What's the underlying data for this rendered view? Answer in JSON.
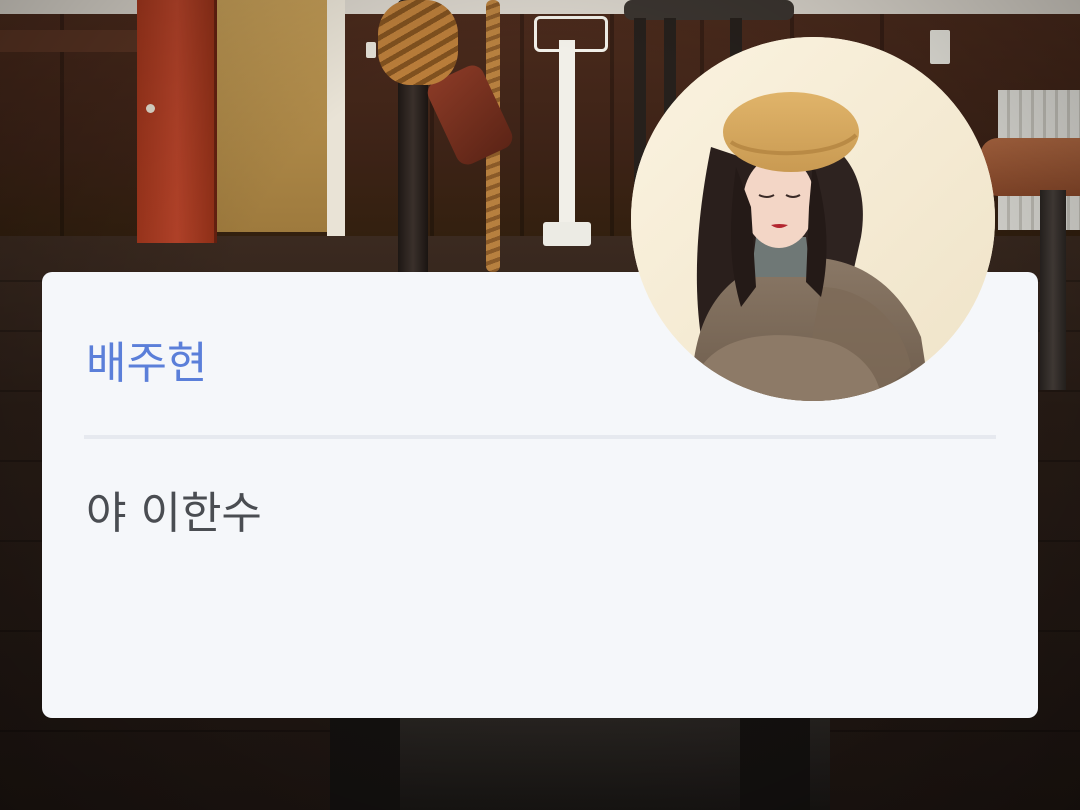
{
  "card": {
    "sender_name": "배주현",
    "message_text": "야 이한수"
  },
  "colors": {
    "card_background": "#f5f7fa",
    "name_color": "#5b7fd9",
    "message_color": "#4a4d52",
    "divider_color": "#e6e9ef"
  },
  "icons": {
    "avatar": "profile-photo"
  }
}
